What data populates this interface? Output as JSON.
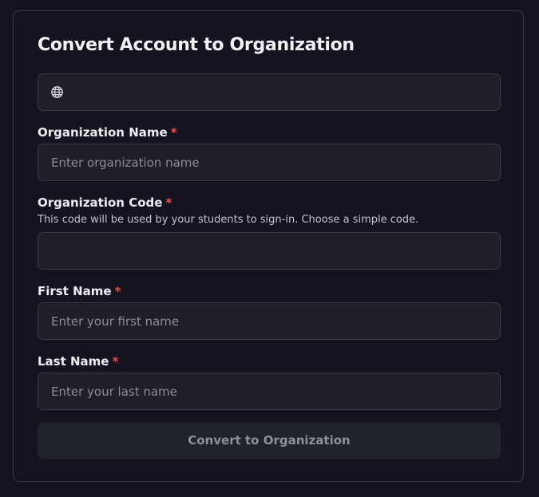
{
  "form": {
    "title": "Convert Account to Organization",
    "domain_field": {
      "icon": "globe-icon",
      "value": ""
    },
    "org_name": {
      "label": "Organization Name",
      "required_mark": "*",
      "placeholder": "Enter organization name"
    },
    "org_code": {
      "label": "Organization Code",
      "required_mark": "*",
      "hint": "This code will be used by your students to sign-in. Choose a simple code.",
      "value": ""
    },
    "first_name": {
      "label": "First Name",
      "required_mark": "*",
      "placeholder": "Enter your first name"
    },
    "last_name": {
      "label": "Last Name",
      "required_mark": "*",
      "placeholder": "Enter your last name"
    },
    "submit_label": "Convert to Organization"
  },
  "colors": {
    "background": "#15131f",
    "input_background": "#1f1f25",
    "required": "#f0484c",
    "button_background": "#22222a"
  }
}
